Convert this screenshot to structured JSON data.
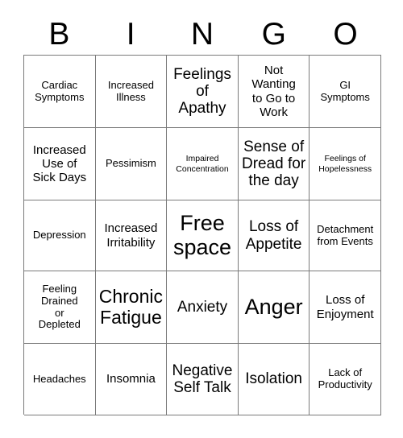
{
  "card": {
    "title": "BINGO",
    "headers": [
      "B",
      "I",
      "N",
      "G",
      "O"
    ],
    "border_color": "#7a7a7a",
    "text_color": "#000000",
    "background_color": "#ffffff",
    "rows": [
      [
        {
          "label": "Cardiac\nSymptoms",
          "size": "sm"
        },
        {
          "label": "Increased\nIllness",
          "size": "sm"
        },
        {
          "label": "Feelings\nof\nApathy",
          "size": "lg"
        },
        {
          "label": "Not\nWanting\nto Go to\nWork",
          "size": "md"
        },
        {
          "label": "GI\nSymptoms",
          "size": "sm"
        }
      ],
      [
        {
          "label": "Increased\nUse of\nSick Days",
          "size": "md"
        },
        {
          "label": "Pessimism",
          "size": "sm"
        },
        {
          "label": "Impaired\nConcentration",
          "size": "xs"
        },
        {
          "label": "Sense of\nDread for\nthe day",
          "size": "lg"
        },
        {
          "label": "Feelings of\nHopelessness",
          "size": "xs"
        }
      ],
      [
        {
          "label": "Depression",
          "size": "sm"
        },
        {
          "label": "Increased\nIrritability",
          "size": "md"
        },
        {
          "label": "Free\nspace",
          "size": "xxl"
        },
        {
          "label": "Loss of\nAppetite",
          "size": "lg"
        },
        {
          "label": "Detachment\nfrom Events",
          "size": "sm"
        }
      ],
      [
        {
          "label": "Feeling\nDrained\nor\nDepleted",
          "size": "sm"
        },
        {
          "label": "Chronic\nFatigue",
          "size": "xl"
        },
        {
          "label": "Anxiety",
          "size": "lg"
        },
        {
          "label": "Anger",
          "size": "xxl"
        },
        {
          "label": "Loss of\nEnjoyment",
          "size": "md"
        }
      ],
      [
        {
          "label": "Headaches",
          "size": "sm"
        },
        {
          "label": "Insomnia",
          "size": "md"
        },
        {
          "label": "Negative\nSelf Talk",
          "size": "lg"
        },
        {
          "label": "Isolation",
          "size": "lg"
        },
        {
          "label": "Lack of\nProductivity",
          "size": "sm"
        }
      ]
    ]
  }
}
